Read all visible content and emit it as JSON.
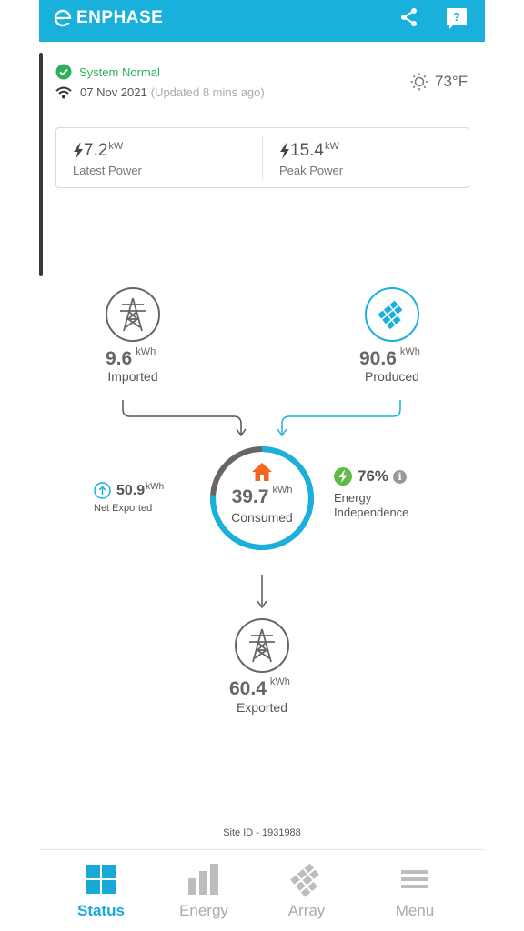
{
  "header": {
    "brand": "ENPHASE",
    "brand_color": "#19b1dc"
  },
  "status": {
    "text": "System Normal",
    "date": "07 Nov 2021",
    "updated": "(Updated 8 mins ago)",
    "temperature": "73°F"
  },
  "power_card": {
    "latest": {
      "value": "7.2",
      "unit": "kW",
      "label": "Latest Power"
    },
    "peak": {
      "value": "15.4",
      "unit": "kW",
      "label": "Peak Power"
    }
  },
  "flow": {
    "imported": {
      "value": "9.6",
      "unit": "kWh",
      "label": "Imported"
    },
    "produced": {
      "value": "90.6",
      "unit": "kWh",
      "label": "Produced"
    },
    "consumed": {
      "value": "39.7",
      "unit": "kWh",
      "label": "Consumed"
    },
    "net_exported": {
      "value": "50.9",
      "unit": "kWh",
      "label": "Net Exported"
    },
    "independence": {
      "value": "76%",
      "label": "Energy Independence"
    },
    "exported": {
      "value": "60.4",
      "unit": "kWh",
      "label": "Exported"
    },
    "consumed_ring_solar_fraction": 0.76
  },
  "footer": {
    "site_id": "Site ID - 1931988"
  },
  "nav": {
    "items": [
      {
        "label": "Status",
        "icon": "grid-icon",
        "active": true
      },
      {
        "label": "Energy",
        "icon": "bar-chart-icon",
        "active": false
      },
      {
        "label": "Array",
        "icon": "solar-panel-icon",
        "active": false
      },
      {
        "label": "Menu",
        "icon": "hamburger-icon",
        "active": false
      }
    ]
  },
  "colors": {
    "accent": "#19b1dc",
    "status_green": "#2eaf5a",
    "home_orange": "#f26522",
    "grid_gray": "#666666",
    "independence_green": "#5fba47"
  }
}
